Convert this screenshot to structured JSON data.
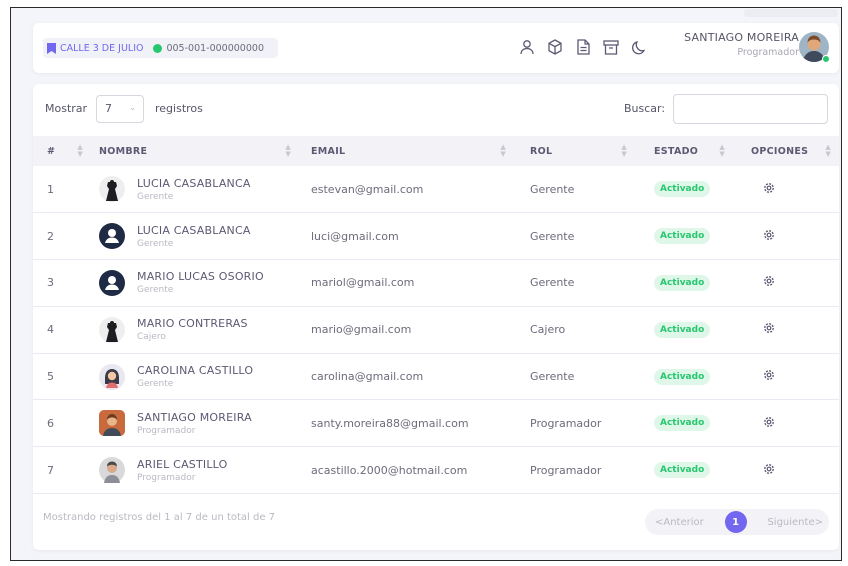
{
  "header": {
    "branch": "CALLE 3 DE JULIO",
    "document_code": "005-001-000000000",
    "icons": [
      "user-icon",
      "box-icon",
      "document-icon",
      "archive-icon",
      "moon-icon"
    ],
    "user_name": "SANTIAGO MOREIRA",
    "user_role": "Programador"
  },
  "controls": {
    "show_label": "Mostrar",
    "page_size": "7",
    "records_label": "registros",
    "search_label": "Buscar:",
    "search_value": ""
  },
  "table": {
    "columns": [
      "#",
      "NOMBRE",
      "EMAIL",
      "ROL",
      "ESTADO",
      "OPCIONES"
    ],
    "rows": [
      {
        "num": "1",
        "name": "LUCIA CASABLANCA",
        "subrole": "Gerente",
        "email": "estevan@gmail.com",
        "rol": "Gerente",
        "estado": "Activado"
      },
      {
        "num": "2",
        "name": "LUCIA CASABLANCA",
        "subrole": "Gerente",
        "email": "luci@gmail.com",
        "rol": "Gerente",
        "estado": "Activado"
      },
      {
        "num": "3",
        "name": "MARIO LUCAS OSORIO",
        "subrole": "Gerente",
        "email": "mariol@gmail.com",
        "rol": "Gerente",
        "estado": "Activado"
      },
      {
        "num": "4",
        "name": "MARIO CONTRERAS",
        "subrole": "Cajero",
        "email": "mario@gmail.com",
        "rol": "Cajero",
        "estado": "Activado"
      },
      {
        "num": "5",
        "name": "CAROLINA CASTILLO",
        "subrole": "Gerente",
        "email": "carolina@gmail.com",
        "rol": "Gerente",
        "estado": "Activado"
      },
      {
        "num": "6",
        "name": "SANTIAGO MOREIRA",
        "subrole": "Programador",
        "email": "santy.moreira88@gmail.com",
        "rol": "Programador",
        "estado": "Activado"
      },
      {
        "num": "7",
        "name": "ARIEL CASTILLO",
        "subrole": "Programador",
        "email": "acastillo.2000@hotmail.com",
        "rol": "Programador",
        "estado": "Activado"
      }
    ]
  },
  "footer": {
    "summary": "Mostrando registros del 1 al 7 de un total de 7",
    "prev_label": "<Anterior",
    "current_page": "1",
    "next_label": "Siguiente>"
  },
  "colors": {
    "accent": "#7367f0",
    "success": "#28c76f",
    "success_bg": "#dff7e9"
  }
}
